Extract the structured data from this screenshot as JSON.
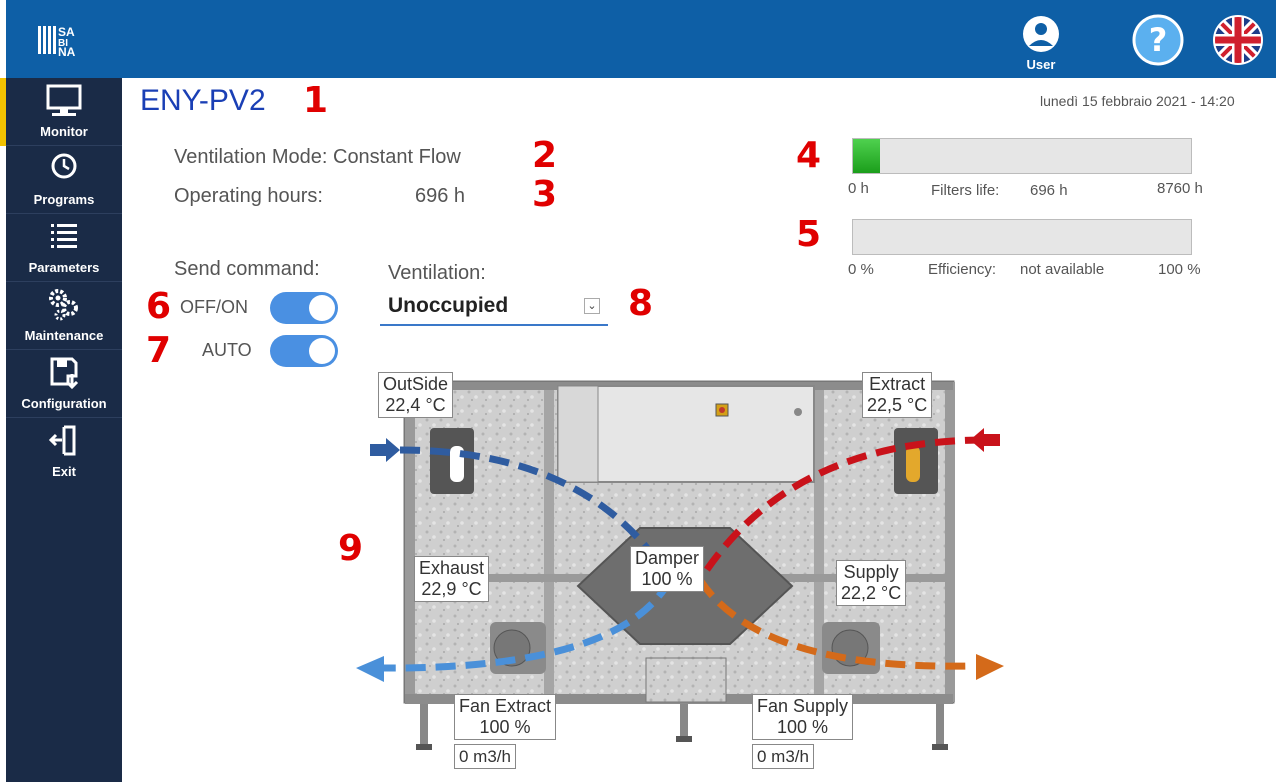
{
  "header": {
    "user_label": "User",
    "datetime": "lunedì 15 febbraio 2021 - 14:20",
    "colors": {
      "topbar": "#0e5fa6",
      "sidebar": "#1a2b47",
      "accent": "#f2c200"
    }
  },
  "sidebar": {
    "items": [
      {
        "label": "Monitor",
        "icon": "monitor-icon"
      },
      {
        "label": "Programs",
        "icon": "clock-icon"
      },
      {
        "label": "Parameters",
        "icon": "list-icon"
      },
      {
        "label": "Maintenance",
        "icon": "gears-icon"
      },
      {
        "label": "Configuration",
        "icon": "save-config-icon"
      },
      {
        "label": "Exit",
        "icon": "exit-icon"
      }
    ]
  },
  "device": {
    "name": "ENY-PV2"
  },
  "status": {
    "ventilation_mode": "Ventilation Mode: Constant Flow",
    "operating_hours_label": "Operating hours:",
    "operating_hours_value": "696 h"
  },
  "filters": {
    "min_label": "0 h",
    "caption": "Filters life:",
    "value_label": "696 h",
    "max_label": "8760 h",
    "fraction": 0.0795
  },
  "efficiency": {
    "min_label": "0 %",
    "caption": "Efficiency:",
    "value_label": "not available",
    "max_label": "100 %"
  },
  "controls": {
    "send_command_label": "Send command:",
    "off_on_label": "OFF/ON",
    "off_on_state": true,
    "auto_label": "AUTO",
    "auto_state": true,
    "ventilation_label": "Ventilation:",
    "ventilation_value": "Unoccupied"
  },
  "diagram": {
    "outside": {
      "name": "OutSide",
      "value": "22,4 °C"
    },
    "extract": {
      "name": "Extract",
      "value": "22,5 °C"
    },
    "exhaust": {
      "name": "Exhaust",
      "value": "22,9 °C"
    },
    "supply": {
      "name": "Supply",
      "value": "22,2 °C"
    },
    "damper": {
      "name": "Damper",
      "value": "100 %"
    },
    "fan_extract": {
      "name": "Fan Extract",
      "value": "100 %",
      "flow": "0 m3/h"
    },
    "fan_supply": {
      "name": "Fan Supply",
      "value": "100 %",
      "flow": "0 m3/h"
    }
  },
  "annotations": [
    "1",
    "2",
    "3",
    "4",
    "5",
    "6",
    "7",
    "8",
    "9"
  ]
}
